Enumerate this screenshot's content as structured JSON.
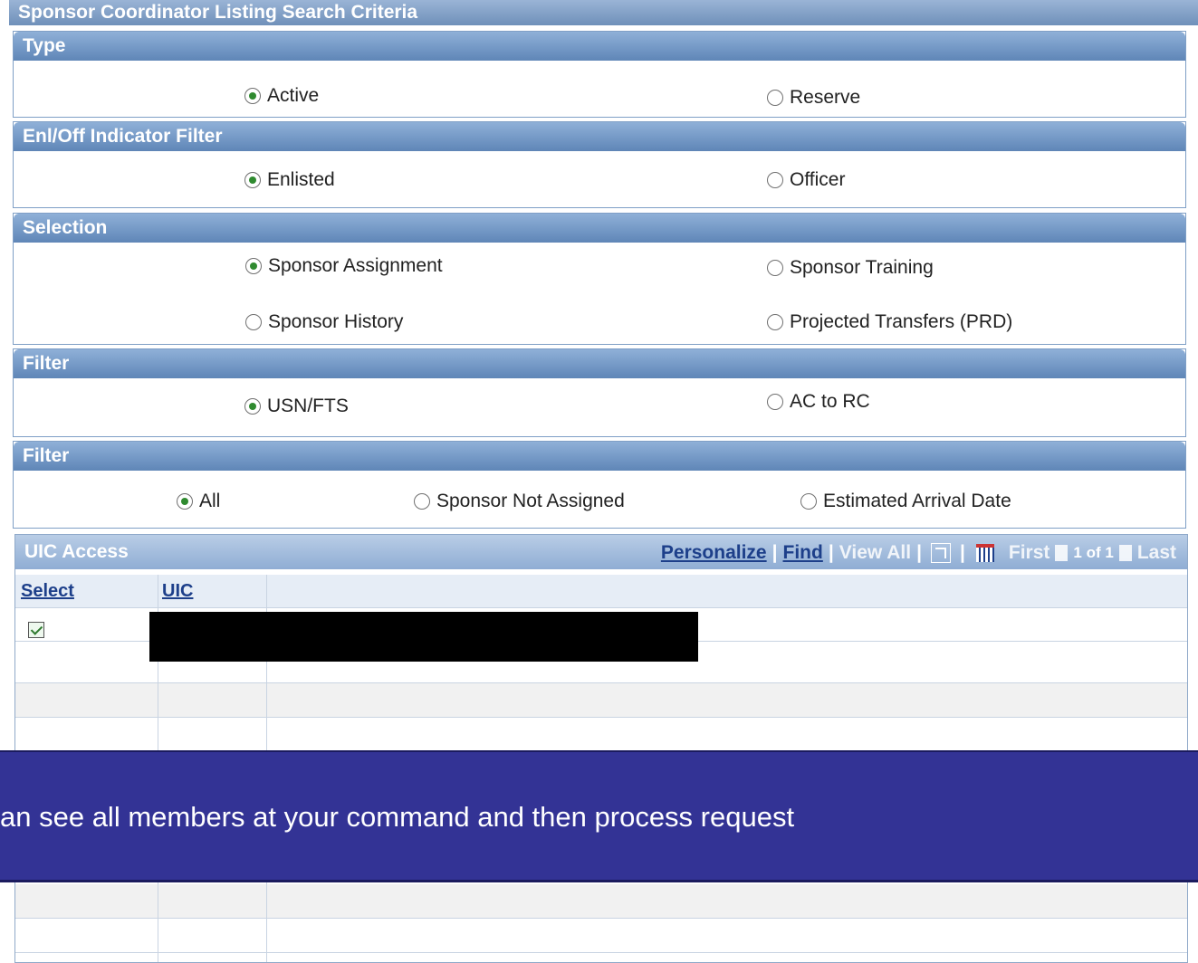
{
  "page_title": "Sponsor Coordinator Listing Search Criteria",
  "sections": {
    "type": {
      "title": "Type",
      "options": [
        "Active",
        "Reserve"
      ]
    },
    "enl_off": {
      "title": "Enl/Off Indicator Filter",
      "options": [
        "Enlisted",
        "Officer"
      ]
    },
    "selection": {
      "title": "Selection",
      "options": [
        "Sponsor Assignment",
        "Sponsor Training",
        "Sponsor History",
        "Projected Transfers (PRD)"
      ]
    },
    "filter1": {
      "title": "Filter",
      "options": [
        "USN/FTS",
        "AC to RC"
      ]
    },
    "filter2": {
      "title": "Filter",
      "options": [
        "All",
        "Sponsor Not Assigned",
        "Estimated Arrival Date"
      ]
    }
  },
  "grid": {
    "title": "UIC Access",
    "nav": {
      "personalize": "Personalize",
      "find": "Find",
      "view_all": "View All",
      "first": "First",
      "page_info": "1 of 1",
      "last": "Last",
      "sep": "|"
    },
    "columns": [
      "Select",
      "UIC"
    ]
  },
  "banner": {
    "text": "an see all members at your command and then process request"
  },
  "colors": {
    "accent": "#333395",
    "header_blue": "#6f90ba",
    "link": "#1d3f8a"
  }
}
